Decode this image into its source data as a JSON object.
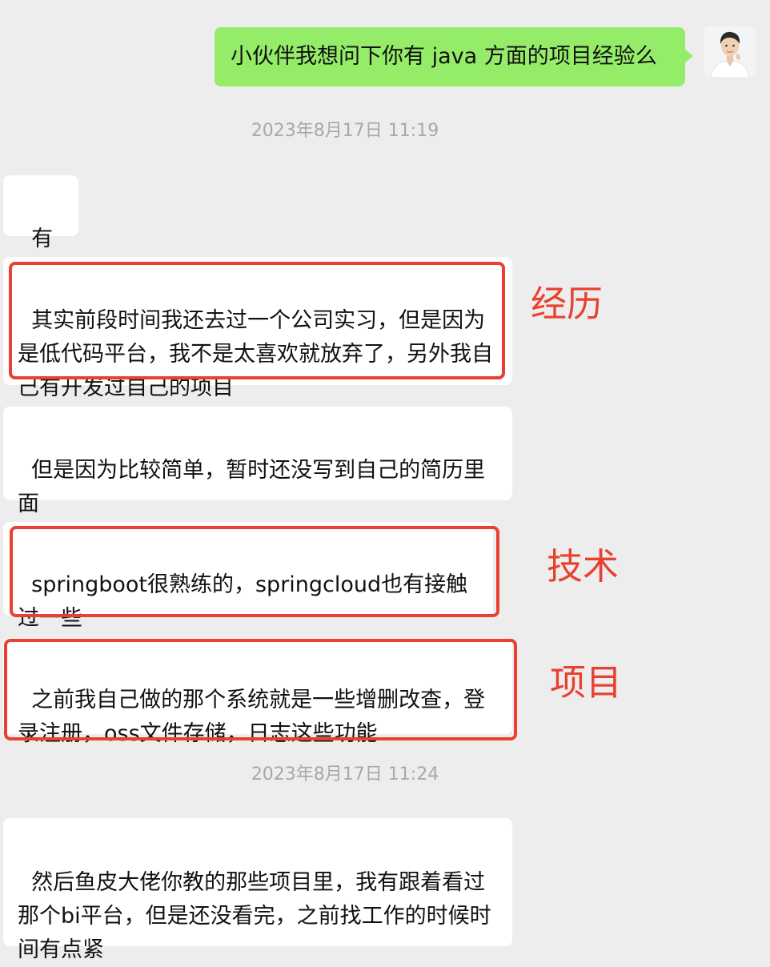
{
  "outgoing_message": "小伙伴我想问下你有 java 方面的项目经验么",
  "timestamps": [
    "2023年8月17日 11:19",
    "2023年8月17日 11:24"
  ],
  "incoming_messages": [
    "有的",
    "其实前段时间我还去过一个公司实习，但是因为是低代码平台，我不是太喜欢就放弃了，另外我自己有开发过自己的项目",
    "但是因为比较简单，暂时还没写到自己的简历里面",
    "springboot很熟练的，springcloud也有接触过一些",
    "之前我自己做的那个系统就是一些增删改查，登录注册，oss文件存储，日志这些功能",
    "然后鱼皮大佬你教的那些项目里，我有跟着看过那个bi平台，但是还没看完，之前找工作的时候时间有点紧"
  ],
  "annotations": [
    "经历",
    "技术",
    "项目"
  ],
  "colors": {
    "background": "#ededed",
    "outgoing_bubble": "#95ec69",
    "incoming_bubble": "#ffffff",
    "highlight": "#e8412f",
    "timestamp": "#a8a8a8"
  },
  "icons": {
    "avatar": "user-avatar-photo"
  }
}
